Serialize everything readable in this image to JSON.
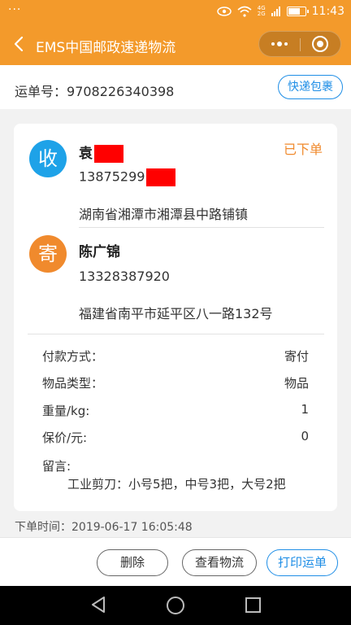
{
  "status_bar": {
    "left_dots": "···",
    "eye_icon": "eye-icon",
    "wifi_icon": "wifi-icon",
    "net_top": "4G",
    "net_bottom": "2G",
    "time": "11:43"
  },
  "nav": {
    "title": "EMS中国邮政速递物流"
  },
  "waybill": {
    "label": "运单号：",
    "number": "9708226340398",
    "package_button": "快递包裹"
  },
  "receiver": {
    "badge": "收",
    "name": "袁",
    "phone": "13875299",
    "address": "湖南省湘潭市湘潭县中路铺镇",
    "status": "已下单"
  },
  "sender": {
    "badge": "寄",
    "name": "陈广锦",
    "phone": "13328387920",
    "address": "福建省南平市延平区八一路132号"
  },
  "details": {
    "payment_label": "付款方式：",
    "payment_value": "寄付",
    "item_type_label": "物品类型：",
    "item_type_value": "物品",
    "weight_label": "重量/kg:",
    "weight_value": "1",
    "insured_label": "保价/元:",
    "insured_value": "0",
    "message_label": "留言:",
    "message_value": "工业剪刀：小号5把，中号3把，大号2把"
  },
  "order_time": "下单时间：2019-06-17 16:05:48",
  "actions": {
    "delete": "删除",
    "track": "查看物流",
    "print": "打印运单"
  },
  "colors": {
    "brand_orange": "#f39a2b",
    "accent_blue": "#1f8ee6",
    "receiver_blue": "#1ea2e8",
    "sender_orange": "#f08a2d",
    "redaction_red": "#ff0000"
  }
}
